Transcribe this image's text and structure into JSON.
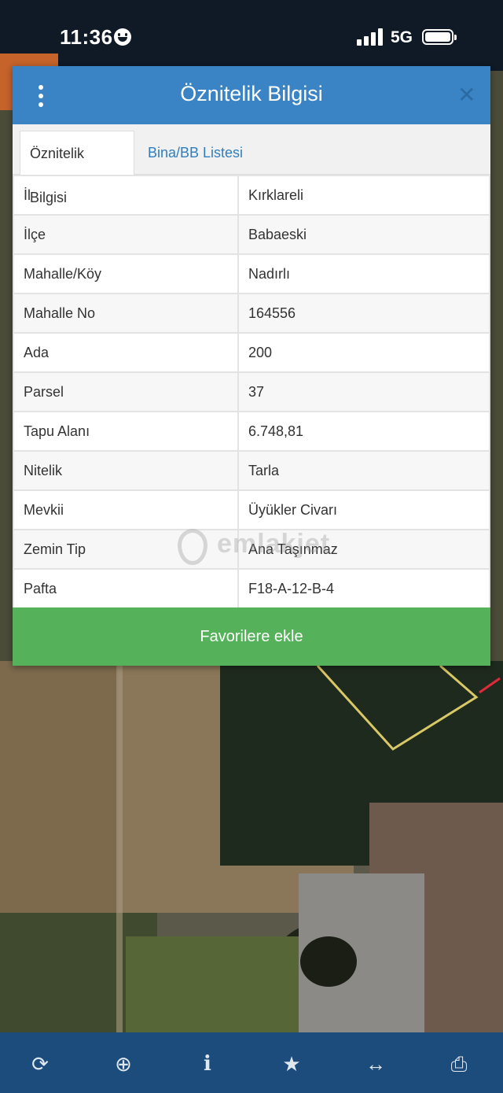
{
  "status_bar": {
    "time": "11:36",
    "network": "5G"
  },
  "dialog": {
    "title": "Öznitelik Bilgisi",
    "tabs": [
      {
        "label": "Öznitelik Bilgisi",
        "active": true
      },
      {
        "label": "Bina/BB Listesi",
        "active": false
      }
    ],
    "rows": [
      {
        "key": "İl",
        "value": "Kırklareli"
      },
      {
        "key": "İlçe",
        "value": "Babaeski"
      },
      {
        "key": "Mahalle/Köy",
        "value": "Nadırlı"
      },
      {
        "key": "Mahalle No",
        "value": "164556"
      },
      {
        "key": "Ada",
        "value": "200"
      },
      {
        "key": "Parsel",
        "value": "37"
      },
      {
        "key": "Tapu Alanı",
        "value": "6.748,81"
      },
      {
        "key": "Nitelik",
        "value": "Tarla"
      },
      {
        "key": "Mevkii",
        "value": "Üyükler Civarı"
      },
      {
        "key": "Zemin Tip",
        "value": "Ana Taşınmaz"
      },
      {
        "key": "Pafta",
        "value": "F18-A-12-B-4"
      }
    ],
    "button_label": "Favorilere ekle"
  },
  "watermark": "emlakjet",
  "toolbar": {
    "icons": [
      "refresh-icon",
      "locate-icon",
      "info-icon",
      "star-icon",
      "measure-icon",
      "print-icon"
    ],
    "glyphs": [
      "⟳",
      "⊕",
      "i",
      "★",
      "↔",
      "⎙"
    ]
  },
  "colors": {
    "header_blue": "#3a83c4",
    "tab_link": "#2f7fbf",
    "button_green": "#55b25a",
    "toolbar": "#1c4c7c"
  }
}
